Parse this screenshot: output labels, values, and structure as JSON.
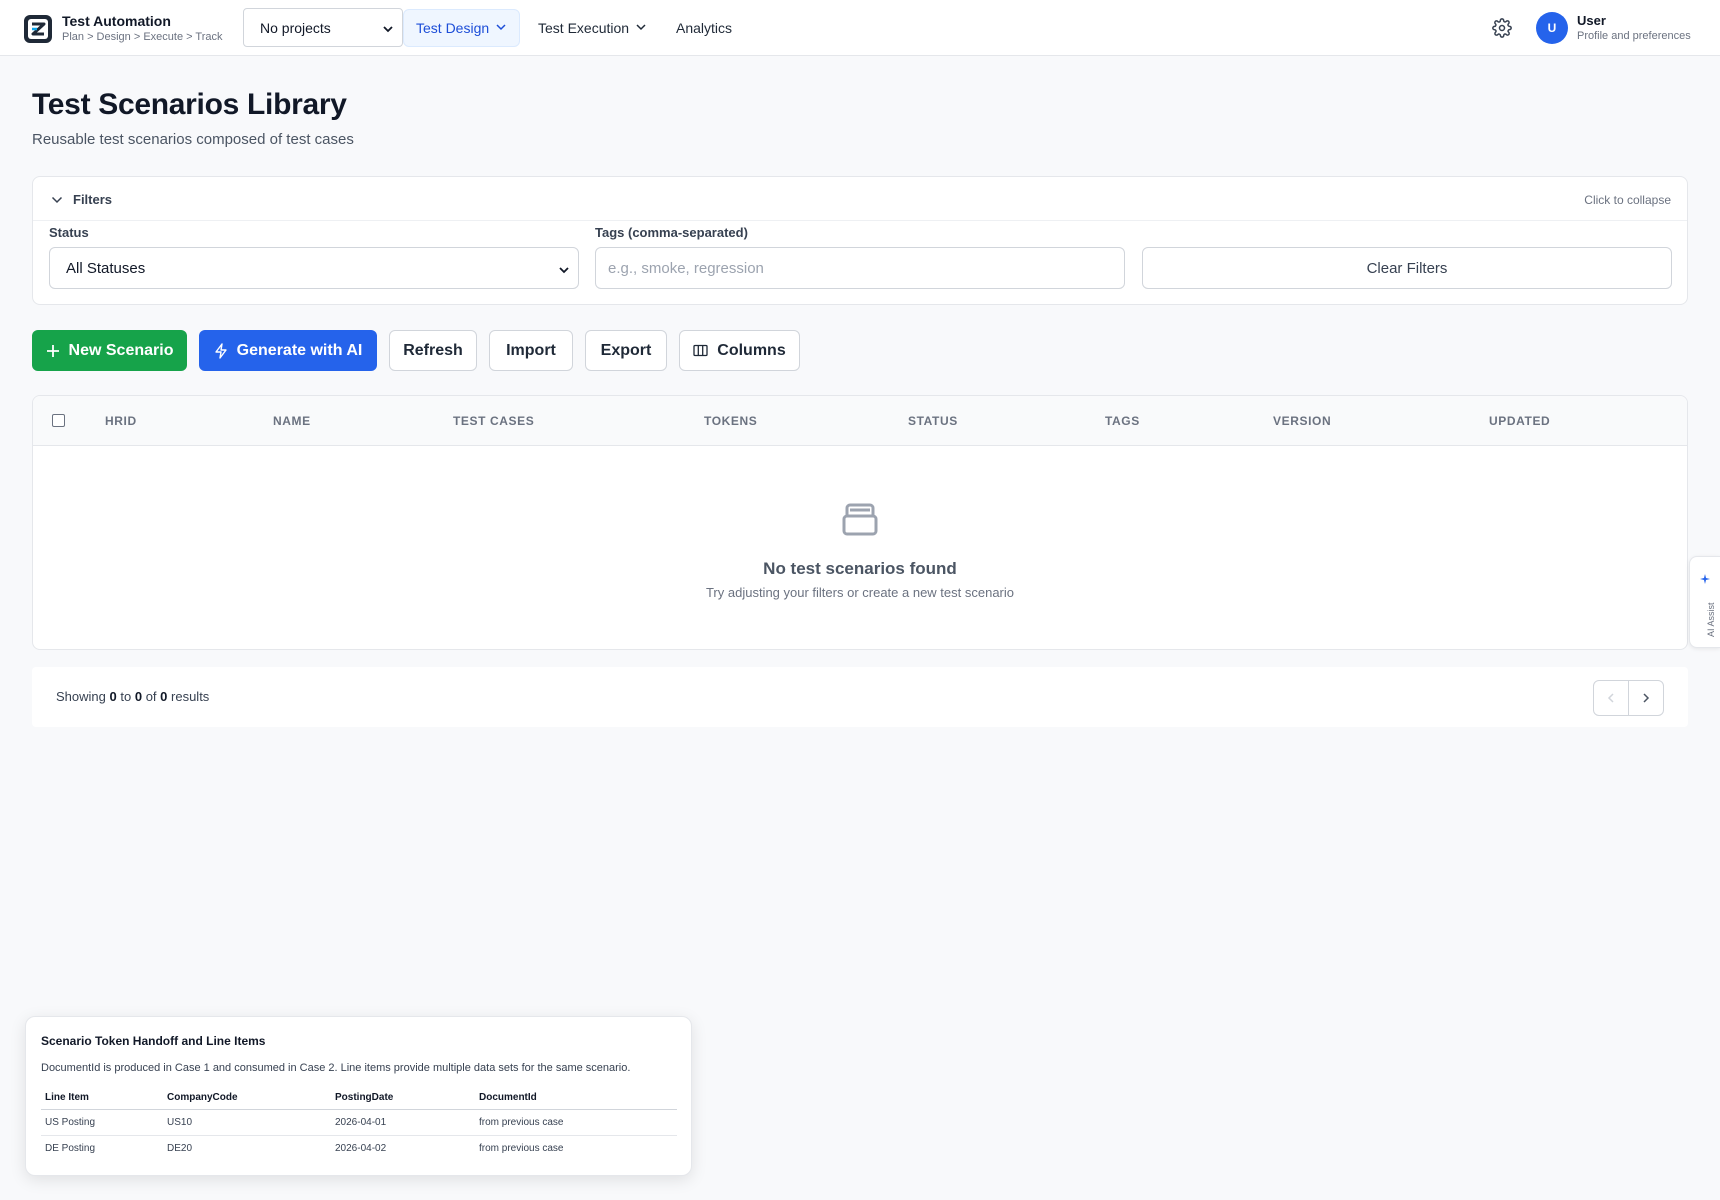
{
  "app": {
    "title": "Test Automation",
    "subtitle": "Plan > Design > Execute > Track"
  },
  "nav": {
    "project_select": "No projects",
    "items": [
      {
        "label": "Test Design",
        "active": true,
        "has_menu": true
      },
      {
        "label": "Test Execution",
        "active": false,
        "has_menu": true
      },
      {
        "label": "Analytics",
        "active": false,
        "has_menu": false
      }
    ]
  },
  "user": {
    "initial": "U",
    "name": "User",
    "subtitle": "Profile and preferences"
  },
  "page": {
    "title": "Test Scenarios Library",
    "subtitle": "Reusable test scenarios composed of test cases"
  },
  "filters": {
    "title": "Filters",
    "collapse_hint": "Click to collapse",
    "status_label": "Status",
    "status_value": "All Statuses",
    "tags_label": "Tags (comma-separated)",
    "tags_value": "",
    "tags_placeholder": "e.g., smoke, regression",
    "clear_label": "Clear Filters"
  },
  "actions": {
    "new_scenario": "New Scenario",
    "generate_ai": "Generate with AI",
    "refresh": "Refresh",
    "import": "Import",
    "export": "Export",
    "columns": "Columns"
  },
  "table": {
    "columns": [
      "HRID",
      "NAME",
      "TEST CASES",
      "TOKENS",
      "STATUS",
      "TAGS",
      "VERSION",
      "UPDATED"
    ],
    "rows": [],
    "empty_title": "No test scenarios found",
    "empty_subtitle": "Try adjusting your filters or create a new test scenario"
  },
  "pagination": {
    "prefix": "Showing",
    "from": "0",
    "to_word": "to",
    "to": "0",
    "of_word": "of",
    "total": "0",
    "suffix": "results"
  },
  "ai_assist": {
    "label": "AI Assist"
  },
  "card": {
    "title": "Scenario Token Handoff and Line Items",
    "description": "DocumentId is produced in Case 1 and consumed in Case 2. Line items provide multiple data sets for the same scenario.",
    "columns": [
      "Line Item",
      "CompanyCode",
      "PostingDate",
      "DocumentId"
    ],
    "rows": [
      [
        "US Posting",
        "US10",
        "2026-04-01",
        "from previous case"
      ],
      [
        "DE Posting",
        "DE20",
        "2026-04-02",
        "from previous case"
      ]
    ]
  },
  "colors": {
    "primary": "#2563eb",
    "success": "#16a34a",
    "nav_active_bg": "#eff6ff",
    "page_bg": "#f8f9fb"
  }
}
